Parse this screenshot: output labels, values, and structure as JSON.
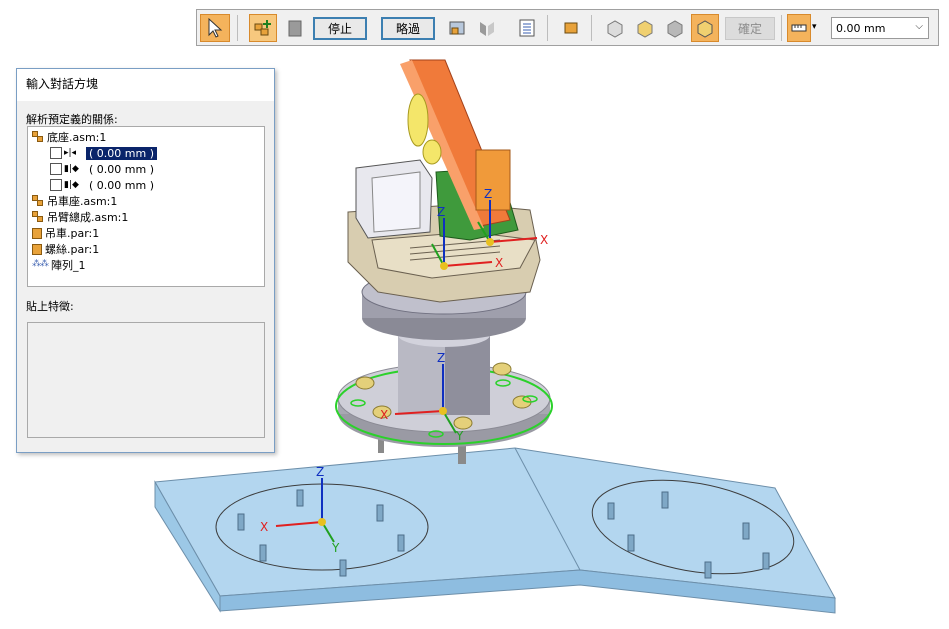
{
  "toolbar": {
    "stop_label": "停止",
    "skip_label": "略過",
    "confirm_label": "確定",
    "offset_value": "0.00 mm",
    "icons": [
      "select-arrow-icon",
      "add-assembly-icon",
      "copy-icon",
      "paste-feature-icon",
      "flip-icon",
      "parts-list-icon",
      "orange-box-icon",
      "view-icon-1",
      "view-icon-2",
      "view-icon-3",
      "view-icon-4",
      "measure-icon"
    ]
  },
  "dialog": {
    "title": "輸入對話方塊",
    "relations_label": "解析預定義的關係:",
    "paste_label": "貼上特徵:",
    "tree": [
      {
        "name": "底座.asm:1",
        "type": "assembly"
      },
      {
        "value": "( 0.00 mm )",
        "relation": "coplanar",
        "selected": true
      },
      {
        "value": "( 0.00 mm )",
        "relation": "axial",
        "selected": false
      },
      {
        "value": "( 0.00 mm )",
        "relation": "axial",
        "selected": false
      },
      {
        "name": "吊車座.asm:1",
        "type": "assembly"
      },
      {
        "name": "吊臂總成.asm:1",
        "type": "assembly"
      },
      {
        "name": "吊車.par:1",
        "type": "part"
      },
      {
        "name": "螺絲.par:1",
        "type": "part"
      },
      {
        "name": "陣列_1",
        "type": "pattern"
      }
    ]
  },
  "viewport": {
    "axis_labels": {
      "x": "X",
      "y": "Y",
      "z": "Z"
    },
    "colors": {
      "base_plate": "#a9cfe9",
      "arm": "#f07a3a",
      "selection": "#2bd12b",
      "x_axis": "#e02020",
      "y_axis": "#20a020",
      "z_axis": "#1030c0"
    }
  }
}
